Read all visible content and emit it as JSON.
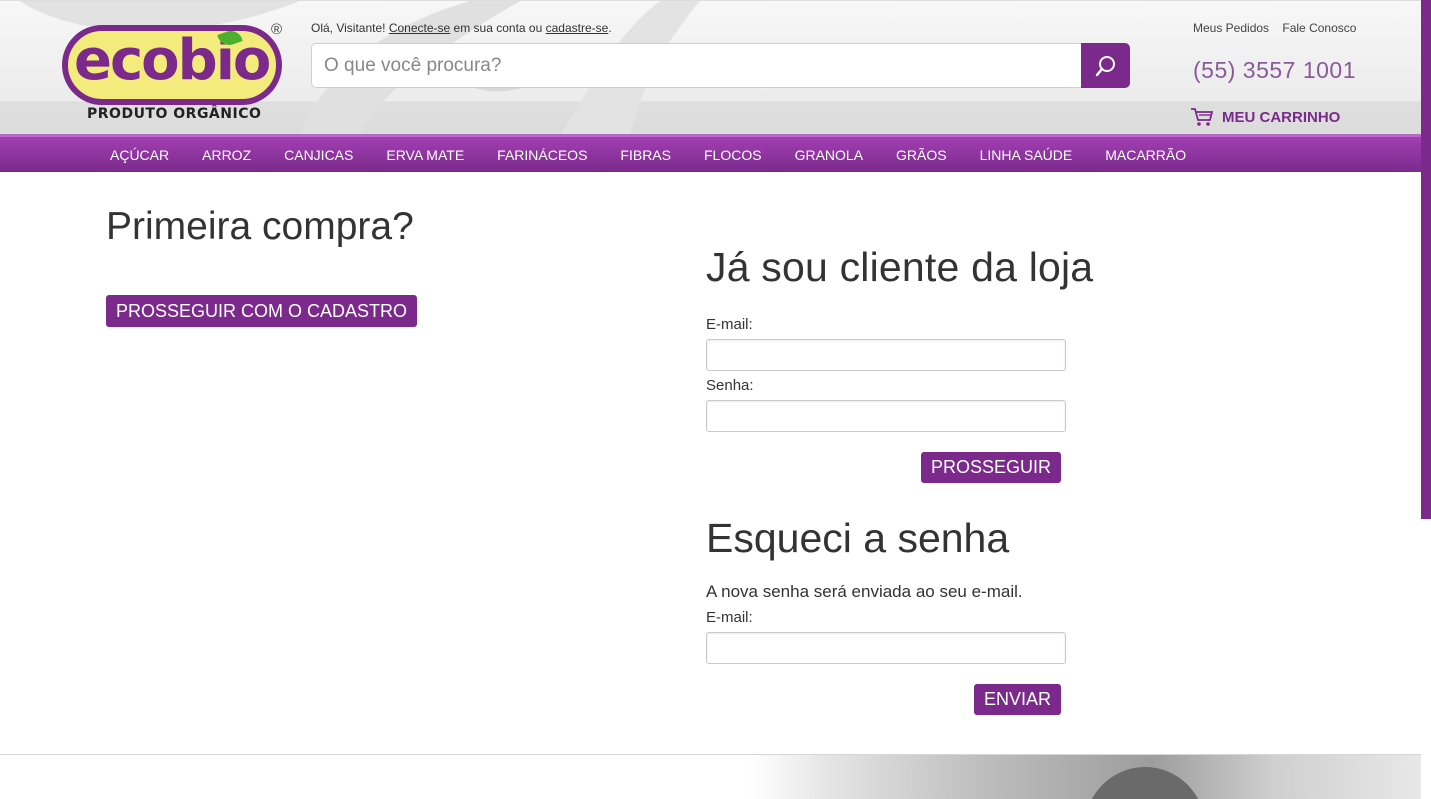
{
  "header": {
    "logo": {
      "word": "ecobio",
      "registered": "®",
      "tagline": "PRODUTO ORGÂNICO"
    },
    "greeting": {
      "prefix": "Olá, Visitante!",
      "login_link": "Conecte-se",
      "middle": "em sua conta ou",
      "signup_link": "cadastre-se",
      "suffix": "."
    },
    "search": {
      "placeholder": "O que você procura?",
      "icon": "search-icon"
    },
    "top_links": [
      "Meus Pedidos",
      "Fale Conosco"
    ],
    "phone": "(55) 3557 1001",
    "cart": {
      "label": "MEU CARRINHO",
      "icon": "cart-icon"
    }
  },
  "nav": {
    "items": [
      "AÇÚCAR",
      "ARROZ",
      "CANJICAS",
      "ERVA MATE",
      "FARINÁCEOS",
      "FIBRAS",
      "FLOCOS",
      "GRANOLA",
      "GRÃOS",
      "LINHA SAÚDE",
      "MACARRÃO"
    ]
  },
  "first_purchase": {
    "title": "Primeira compra?",
    "button": "PROSSEGUIR COM O CADASTRO"
  },
  "login": {
    "title": "Já sou cliente da loja",
    "email_label": "E-mail:",
    "email_value": "",
    "password_label": "Senha:",
    "password_value": "",
    "button": "PROSSEGUIR"
  },
  "forgot": {
    "title": "Esqueci a senha",
    "description": "A nova senha será enviada ao seu e-mail.",
    "email_label": "E-mail:",
    "email_value": "",
    "button": "ENVIAR"
  },
  "colors": {
    "brand_purple": "#7b2a8c",
    "logo_yellow": "#f3ec7c",
    "leaf_green": "#4caf2e"
  }
}
